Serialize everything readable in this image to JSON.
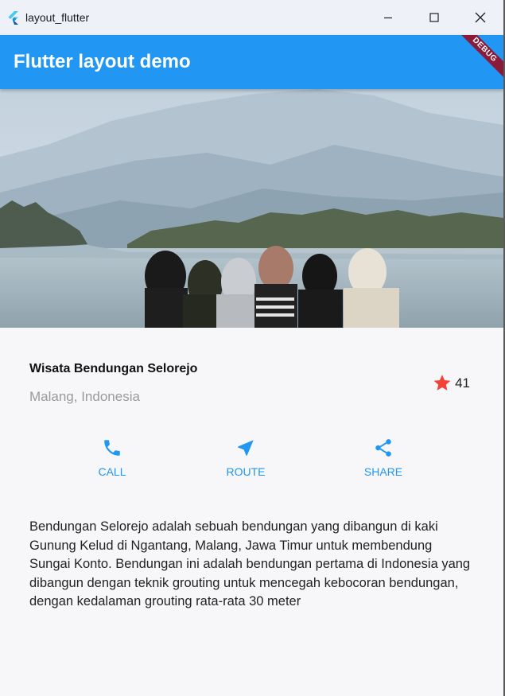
{
  "window": {
    "title": "layout_flutter",
    "icon": "flutter-logo-icon"
  },
  "appbar": {
    "title": "Flutter layout demo",
    "debug_banner": "DEBUG",
    "color": "#2196f3"
  },
  "place": {
    "name": "Wisata Bendungan Selorejo",
    "location": "Malang, Indonesia",
    "rating_count": "41"
  },
  "actions": [
    {
      "label": "CALL",
      "icon": "phone-icon"
    },
    {
      "label": "ROUTE",
      "icon": "navigation-icon"
    },
    {
      "label": "SHARE",
      "icon": "share-icon"
    }
  ],
  "description": "Bendungan Selorejo adalah sebuah bendungan yang dibangun di kaki Gunung Kelud di Ngantang, Malang, Jawa Timur untuk membendung Sungai Konto. Bendungan ini adalah bendungan pertama di Indonesia yang dibangun dengan teknik grouting untuk mencegah kebocoran bendungan, dengan kedalaman grouting rata-rata 30 meter",
  "colors": {
    "accent": "#2196f3",
    "star": "#f44336"
  }
}
